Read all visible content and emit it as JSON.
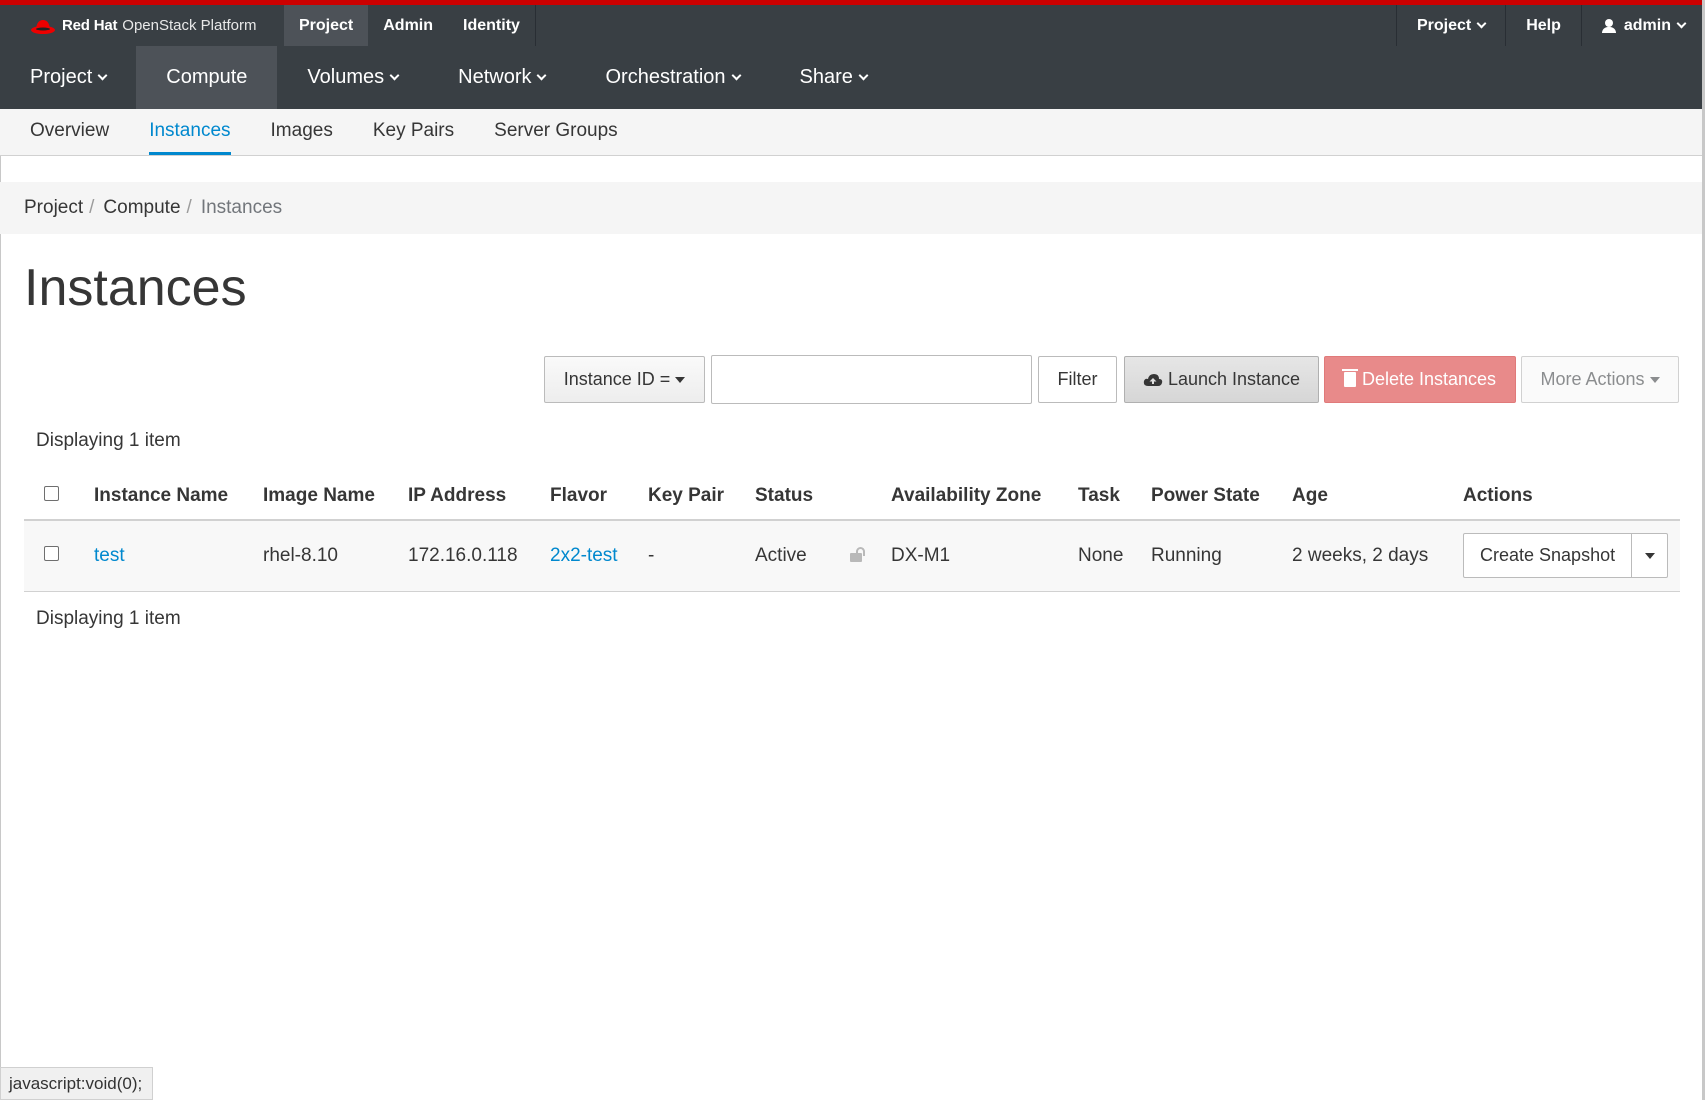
{
  "masthead": {
    "brand_bold": "Red Hat",
    "brand_rest": "OpenStack Platform",
    "tabs": [
      {
        "label": "Project",
        "active": true
      },
      {
        "label": "Admin",
        "active": false
      },
      {
        "label": "Identity",
        "active": false
      }
    ],
    "project_menu": "Project",
    "help": "Help",
    "user": "admin"
  },
  "primary_nav": [
    {
      "label": "Project",
      "dropdown": true,
      "active": false
    },
    {
      "label": "Compute",
      "dropdown": false,
      "active": true
    },
    {
      "label": "Volumes",
      "dropdown": true,
      "active": false
    },
    {
      "label": "Network",
      "dropdown": true,
      "active": false
    },
    {
      "label": "Orchestration",
      "dropdown": true,
      "active": false
    },
    {
      "label": "Share",
      "dropdown": true,
      "active": false
    }
  ],
  "secondary_nav": [
    {
      "label": "Overview",
      "active": false
    },
    {
      "label": "Instances",
      "active": true
    },
    {
      "label": "Images",
      "active": false
    },
    {
      "label": "Key Pairs",
      "active": false
    },
    {
      "label": "Server Groups",
      "active": false
    }
  ],
  "breadcrumb": [
    "Project",
    "Compute",
    "Instances"
  ],
  "page_title": "Instances",
  "toolbar": {
    "filter_field": "Instance ID =",
    "filter_value": "",
    "filter_button": "Filter",
    "launch": "Launch Instance",
    "delete": "Delete Instances",
    "more": "More Actions"
  },
  "display_count": "Displaying 1 item",
  "table": {
    "headers": [
      "Instance Name",
      "Image Name",
      "IP Address",
      "Flavor",
      "Key Pair",
      "Status",
      "Availability Zone",
      "Task",
      "Power State",
      "Age",
      "Actions"
    ],
    "rows": [
      {
        "instance_name": "test",
        "image_name": "rhel-8.10",
        "ip_address": "172.16.0.118",
        "flavor": "2x2-test",
        "key_pair": "-",
        "status": "Active",
        "availability_zone": "DX-M1",
        "task": "None",
        "power_state": "Running",
        "age": "2 weeks, 2 days",
        "action": "Create Snapshot"
      }
    ]
  },
  "statusbar": "javascript:void(0);",
  "colors": {
    "masthead": "#393f44",
    "accent_red": "#cc0000",
    "link": "#0088ce",
    "delete": "#e88a8a"
  }
}
